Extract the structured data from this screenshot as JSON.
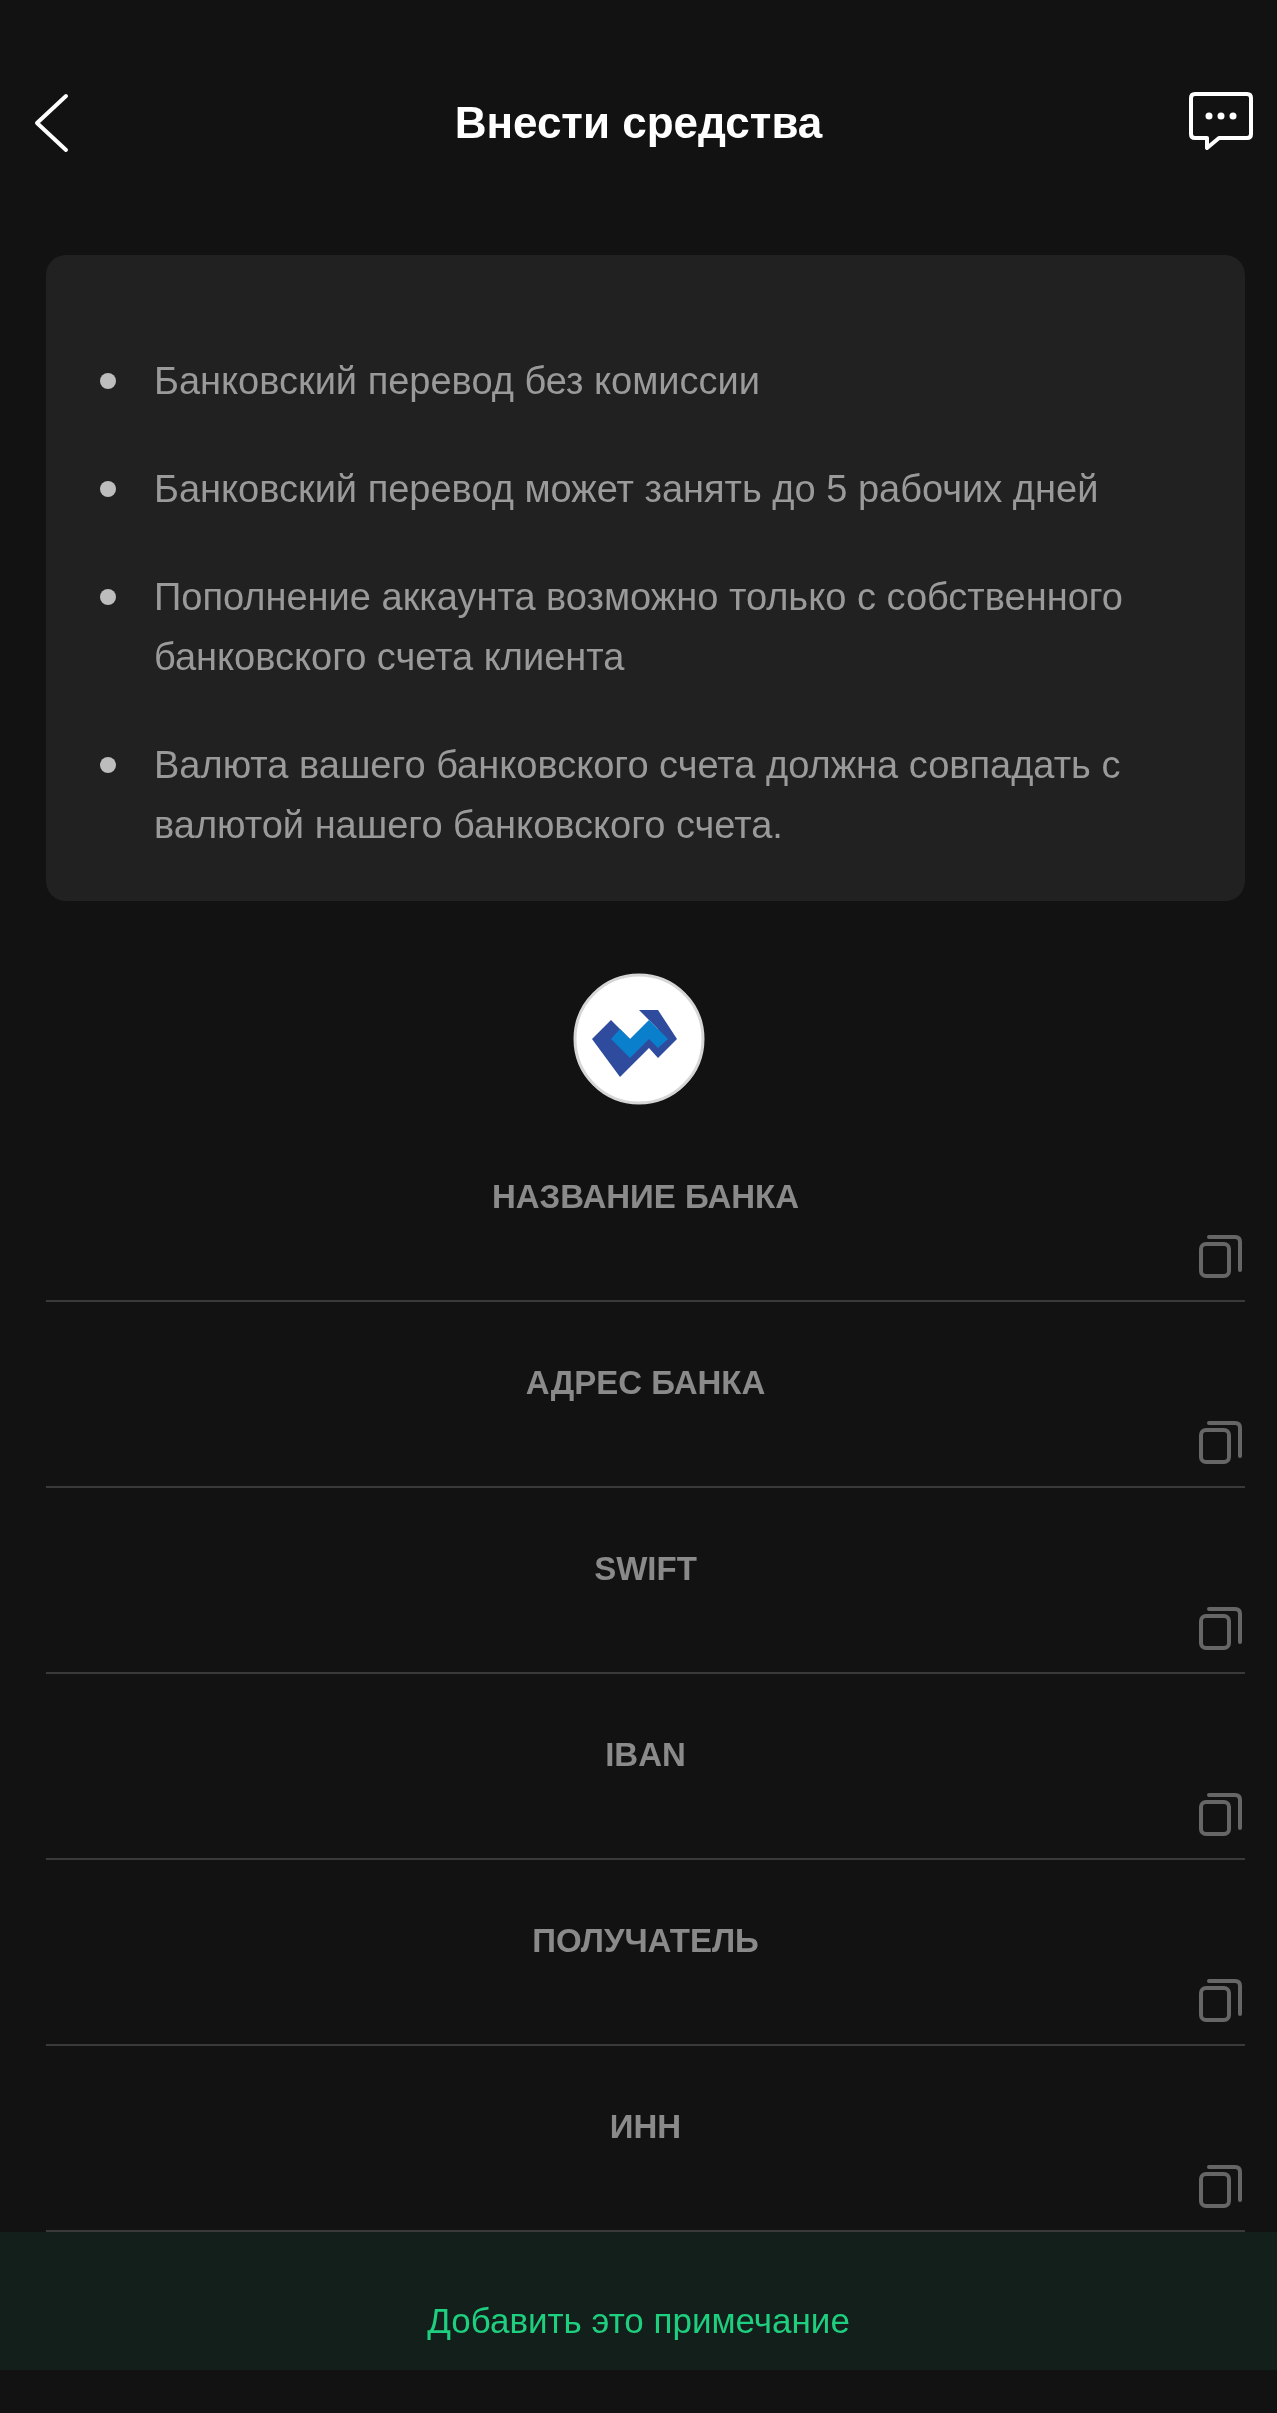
{
  "header": {
    "title": "Внести средства"
  },
  "info": [
    "Банковский перевод без комиссии",
    "Банковский перевод может занять до 5 рабочих дней",
    "Пополнение аккаунта возможно только с собственного банковского счета клиента",
    "Валюта вашего банковского счета должна совпадать с валютой нашего банковского счета."
  ],
  "fields": [
    {
      "label": "НАЗВАНИЕ БАНКА"
    },
    {
      "label": "АДРЕС БАНКА"
    },
    {
      "label": "SWIFT"
    },
    {
      "label": "IBAN"
    },
    {
      "label": "ПОЛУЧАТЕЛЬ"
    },
    {
      "label": "ИНН"
    }
  ],
  "footer": {
    "button": "Добавить это примечание"
  }
}
